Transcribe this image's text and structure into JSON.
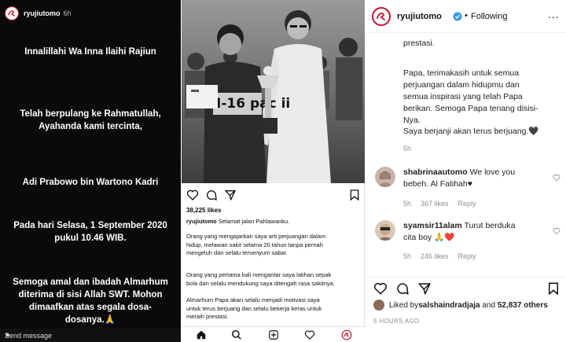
{
  "story": {
    "username": "ryujiutomo",
    "age": "6h",
    "lines": [
      "Innalillahi Wa Inna Ilaihi Rajiun",
      "Telah berpulang ke Rahmatullah,",
      "Ayahanda kami tercinta,",
      "Adi Prabowo bin Wartono Kadri",
      "Pada hari Selasa, 1 September 2020",
      "pukul 10.46 WIB.",
      "Semoga amal dan ibadah Almarhum",
      "diterima di sisi Allah SWT. Mohon",
      "dimaafkan atas segala dosa-",
      "dosanya.🙏"
    ],
    "send_placeholder": "Send message",
    "send_icon": "paper-plane-icon"
  },
  "post": {
    "likes": "38,225 likes",
    "caption_user": "ryujiutomo",
    "caption_first": " Selamat jalan Pahlawanku.",
    "paragraphs": [
      [
        "Orang yang mengajarkan saya arti perjuangan dalam",
        "hidup, melawan sakit selama 20 tahun tanpa pernah",
        "mengeluh dan selalu tersenyum sabar."
      ],
      [
        "Orang yang pertama kali mengantar saya latihan sepak",
        "bola dan selalu mendukung saya ditengah rasa sakitnya."
      ],
      [
        "Almarhum Papa akan selalu menjadi motivasi saya",
        "untuk terus berjuang dan selalu bekerja keras untuk",
        "meraih prestasi."
      ]
    ],
    "photo_caption_text": "I-16 pac ii",
    "nav_icons": [
      "home-icon",
      "search-icon",
      "add-post-icon",
      "heart-icon",
      "profile-icon"
    ]
  },
  "comments": {
    "header": {
      "username": "ryujiutomo",
      "separator": "•",
      "follow_state": "Following",
      "more": "..."
    },
    "caption_tail": [
      "prestasi.",
      "Papa, terimakasih untuk semua",
      "perjuangan dalam hidupmu dan",
      "semua inspirasi yang telah Papa",
      "berikan. Semoga Papa tenang disisi-",
      "Nya.",
      "Saya berjanji akan terus berjuang.🖤"
    ],
    "caption_age": "5h",
    "items": [
      {
        "user": "shabrinaautomo",
        "line1": " We love you",
        "line2": "bebeh. Al Fatihah♥",
        "age": "5h",
        "likes": "367 likes",
        "reply": "Reply"
      },
      {
        "user": "syamsir11alam",
        "line1": " Turut berduka",
        "line2": "cita boy 🙏❤️",
        "age": "5h",
        "likes": "246 likes",
        "reply": "Reply"
      }
    ],
    "liked_by_prefix": "Liked by ",
    "liked_by_user": "salshaindradjaja",
    "liked_by_mid": " and ",
    "liked_by_count": "52,837 others",
    "time_ago": "5 HOURS AGO",
    "colors": {
      "brand": "#c8102e",
      "verified": "#3897f0",
      "meta": "#8e8e8e"
    }
  }
}
